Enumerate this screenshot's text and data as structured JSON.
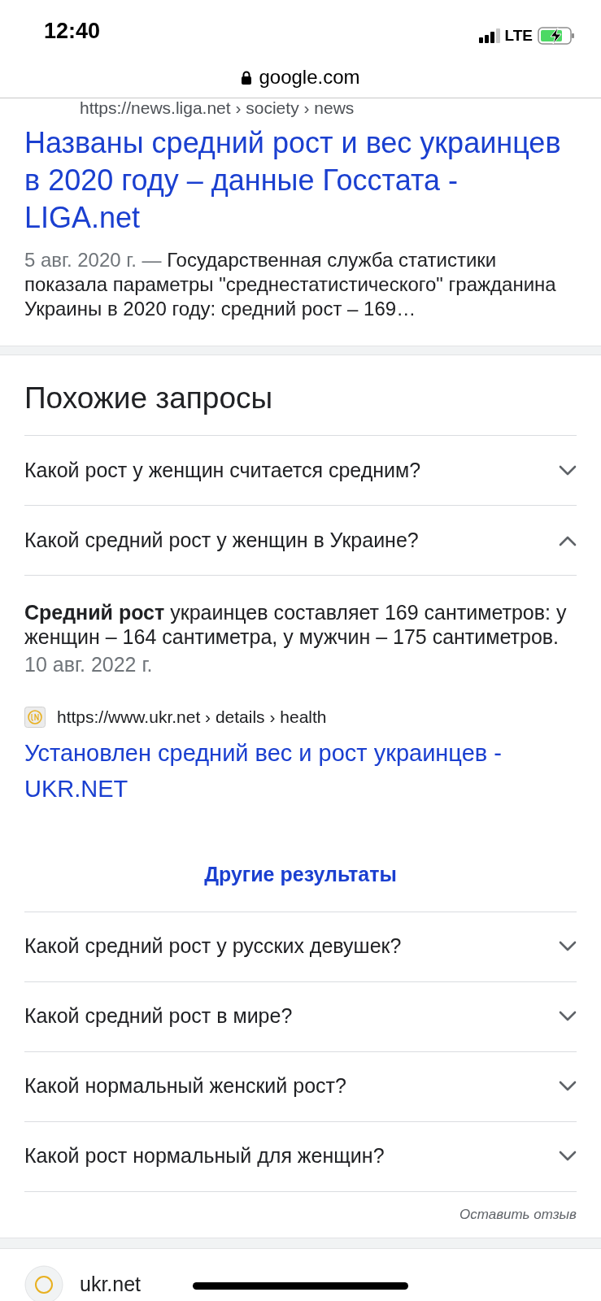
{
  "status_bar": {
    "time": "12:40",
    "network": "LTE",
    "charging": true
  },
  "address_bar": {
    "domain": "google.com"
  },
  "result": {
    "breadcrumb": "https://news.liga.net › society › news",
    "title": "Названы средний рост и вес украинцев в 2020 году – данные Госстата - LIGA.net",
    "date": "5 авг. 2020 г. — ",
    "snippet": "Государственная служба статистики показала параметры \"среднестатистического\" гражданина Украины в 2020 году: средний рост – 169…"
  },
  "related": {
    "heading": "Похожие запросы",
    "questions": [
      {
        "text": "Какой рост у женщин считается средним?",
        "expanded": false
      },
      {
        "text": "Какой средний рост у женщин в Украине?",
        "expanded": true,
        "answer": {
          "text": "**Средний рост** украинцев составляет 169 сантиметров: у женщин – 164 сантиметра, у мужчин – 175 сантиметров.",
          "date": "10 авг. 2022 г.",
          "source_url": "https://www.ukr.net › details › health",
          "link": "Установлен средний вес и рост украинцев - UKR.NET"
        }
      }
    ],
    "more_button": "Другие результаты",
    "more_questions": [
      {
        "text": "Какой средний рост у русских девушек?",
        "expanded": false
      },
      {
        "text": "Какой средний рост в мире?",
        "expanded": false
      },
      {
        "text": "Какой нормальный женский рост?",
        "expanded": false
      },
      {
        "text": "Какой рост нормальный для женщин?",
        "expanded": false
      }
    ]
  },
  "feedback": "Оставить отзыв",
  "next_result": {
    "site": "ukr.net"
  }
}
